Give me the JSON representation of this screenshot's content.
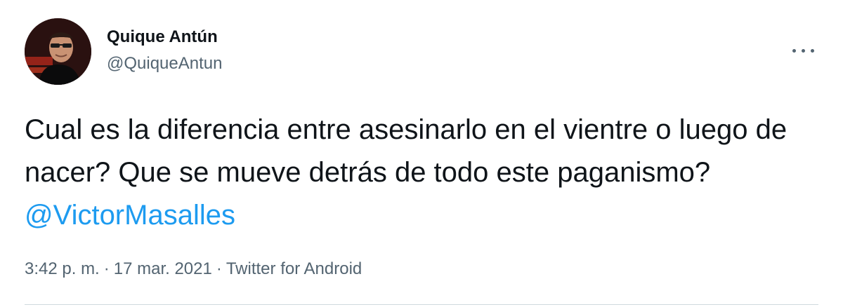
{
  "author": {
    "display_name": "Quique Antún",
    "handle": "@QuiqueAntun",
    "avatar_icon": "profile-photo"
  },
  "menu": {
    "icon": "more-horizontal-icon"
  },
  "tweet": {
    "text": "Cual es la diferencia entre asesinarlo en el vientre o luego de nacer? Que se mueve detrás de todo este paganismo?",
    "mention": "@VictorMasalles"
  },
  "meta": {
    "time": "3:42 p. m.",
    "date": "17 mar. 2021",
    "separator": "·",
    "source": "Twitter for Android"
  },
  "colors": {
    "link": "#1d9bf0",
    "secondary_text": "#536471",
    "primary_text": "#0f1419",
    "divider": "#cfd9de"
  }
}
